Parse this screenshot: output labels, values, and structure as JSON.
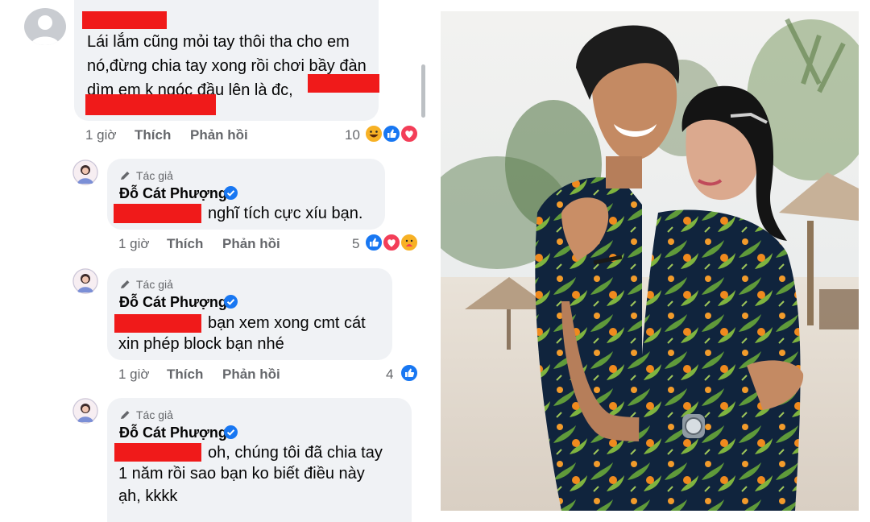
{
  "comments": [
    {
      "text_lines": [
        "Lái lắm cũng mỏi tay thôi tha cho em",
        "nó,đừng chia tay xong rồi chơi bầy đàn",
        "dìm em k ngóc đầu lên là đc,"
      ],
      "time": "1 giờ",
      "like_label": "Thích",
      "reply_label": "Phản hồi",
      "reaction_count": "10",
      "reactions": [
        "haha-icon",
        "like-icon",
        "love-icon"
      ]
    },
    {
      "author_tag": "Tác giả",
      "author": "Đỗ Cát Phượng",
      "text_lines": [
        "nghĩ tích cực xíu bạn."
      ],
      "time": "1 giờ",
      "like_label": "Thích",
      "reply_label": "Phản hồi",
      "reaction_count": "5",
      "reactions": [
        "like-icon",
        "love-icon",
        "care-icon"
      ]
    },
    {
      "author_tag": "Tác giả",
      "author": "Đỗ Cát Phượng",
      "text_lines": [
        "bạn xem xong cmt cát",
        "xin phép block bạn nhé"
      ],
      "time": "1 giờ",
      "like_label": "Thích",
      "reply_label": "Phản hồi",
      "reaction_count": "4",
      "reactions": [
        "like-icon"
      ]
    },
    {
      "author_tag": "Tác giả",
      "author": "Đỗ Cát Phượng",
      "text_lines": [
        "oh, chúng tôi đã chia tay",
        "1 năm rồi sao bạn ko biết điều này",
        "ạh, kkkk"
      ]
    }
  ],
  "colors": {
    "redaction": "#f01a1a",
    "bubble": "#f0f2f5",
    "meta": "#65676b",
    "like": "#1877f2",
    "love": "#f33e58"
  },
  "photo": {
    "subject": "smiling couple in matching tropical shirts on a beach"
  }
}
